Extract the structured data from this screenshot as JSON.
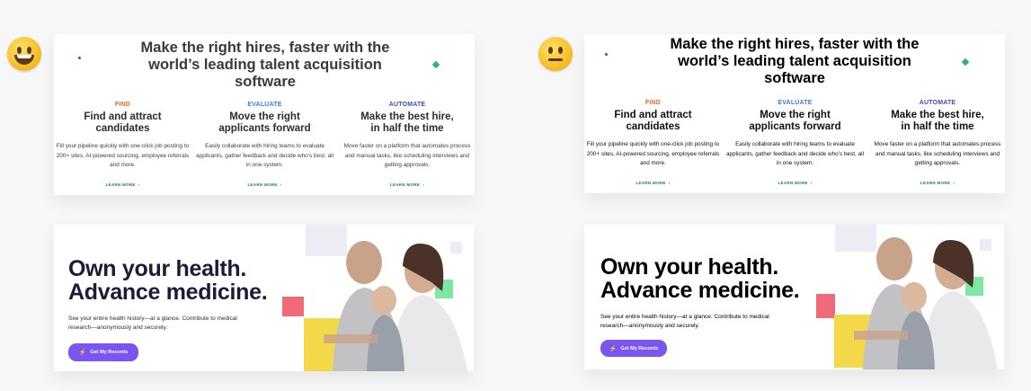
{
  "left": {
    "emoji": "grinning-face-icon",
    "talent": {
      "heading": "Make the right hires, faster with the world’s leading talent acquisition software",
      "columns": [
        {
          "kicker": "FIND",
          "title": "Find and attract candidates",
          "desc": "Fill your pipeline quickly with one-click job posting to 200+ sites, AI-powered sourcing, employee referrals and more.",
          "link": "LEARN MORE"
        },
        {
          "kicker": "EVALUATE",
          "title": "Move the right applicants forward",
          "desc": "Easily collaborate with hiring teams to evaluate applicants, gather feedback and decide who’s best, all in one system.",
          "link": "LEARN MORE"
        },
        {
          "kicker": "AUTOMATE",
          "title": "Make the best hire, in half the time",
          "desc": "Move faster on a platform that automates process and manual tasks, like scheduling interviews and getting approvals.",
          "link": "LEARN MORE"
        }
      ]
    },
    "health": {
      "heading_line1": "Own your health.",
      "heading_line2": "Advance medicine.",
      "body": "See your entire health history—at a glance. Contribute to medical research—anonymously and securely.",
      "button": "Get My Records"
    }
  },
  "right": {
    "emoji": "neutral-face-icon",
    "talent": {
      "heading": "Make the right hires, faster with the world’s leading talent acquisition software",
      "columns": [
        {
          "kicker": "FIND",
          "title": "Find and attract candidates",
          "desc": "Fill your pipeline quickly with one-click job posting to 200+ sites, AI-powered sourcing, employee referrals and more.",
          "link": "LEARN MORE"
        },
        {
          "kicker": "EVALUATE",
          "title": "Move the right applicants forward",
          "desc": "Easily collaborate with hiring teams to evaluate applicants, gather feedback and decide who’s best, all in one system.",
          "link": "LEARN MORE"
        },
        {
          "kicker": "AUTOMATE",
          "title": "Make the best hire, in half the time",
          "desc": "Move faster on a platform that automates process and manual tasks, like scheduling interviews and getting approvals.",
          "link": "LEARN MORE"
        }
      ]
    },
    "health": {
      "heading_line1": "Own your health.",
      "heading_line2": "Advance medicine.",
      "body": "See your entire health history—at a glance. Contribute to medical research—anonymously and securely.",
      "button": "Get My Records"
    }
  },
  "colors": {
    "find": "#f2642a",
    "evaluate": "#3b7dd8",
    "automate": "#3b4bbf",
    "button": "#7a55f0",
    "heading_left": "#333333",
    "heading_right": "#000000",
    "pink": "#f06a7a",
    "green": "#7ee8a0",
    "yellow": "#f3d84a"
  }
}
